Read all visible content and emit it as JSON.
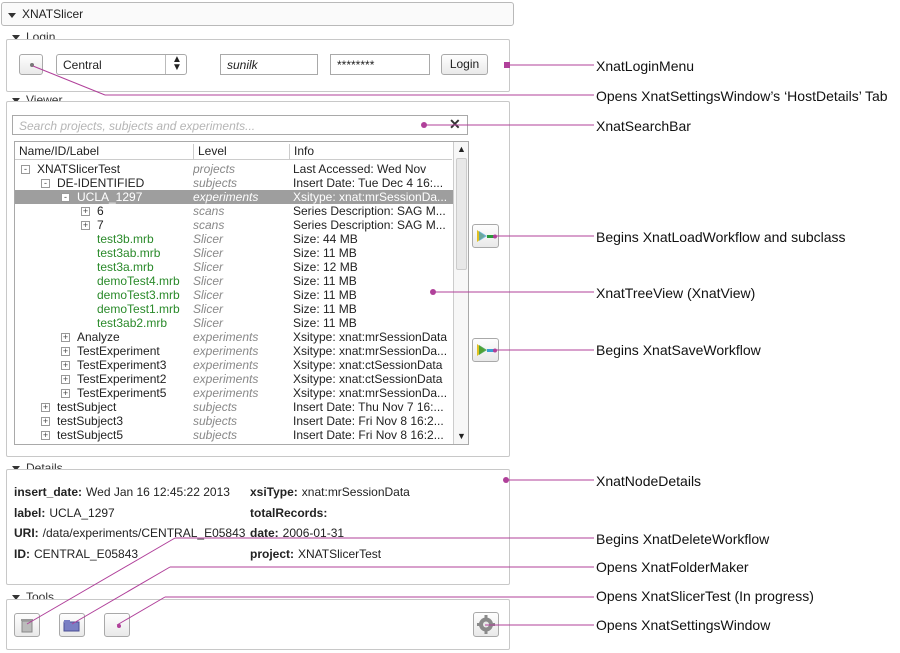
{
  "app": {
    "title": "XNATSlicer"
  },
  "login": {
    "section_label": "Login",
    "host": "Central",
    "username": "sunilk",
    "password": "********",
    "login_button": "Login"
  },
  "viewer": {
    "section_label": "Viewer",
    "search_placeholder": "Search projects, subjects and experiments...",
    "columns": [
      "Name/ID/Label",
      "Level",
      "Info"
    ],
    "rows": [
      {
        "name": "XNATSlicerTest",
        "level": "projects",
        "info": "Last Accessed: Wed Nov",
        "depth": 0,
        "exp": "-",
        "green": false,
        "sel": false
      },
      {
        "name": "DE-IDENTIFIED",
        "level": "subjects",
        "info": "Insert Date: Tue Dec  4 16:...",
        "depth": 1,
        "exp": "-",
        "green": false,
        "sel": false
      },
      {
        "name": "UCLA_1297",
        "level": "experiments",
        "info": "Xsitype: xnat:mrSessionDa...",
        "depth": 2,
        "exp": "-",
        "green": false,
        "sel": true
      },
      {
        "name": "6",
        "level": "scans",
        "info": "Series Description: SAG M...",
        "depth": 3,
        "exp": "+",
        "green": false,
        "sel": false
      },
      {
        "name": "7",
        "level": "scans",
        "info": "Series Description: SAG M...",
        "depth": 3,
        "exp": "+",
        "green": false,
        "sel": false
      },
      {
        "name": "test3b.mrb",
        "level": "Slicer",
        "info": "Size: 44 MB",
        "depth": 3,
        "exp": "",
        "green": true,
        "sel": false
      },
      {
        "name": "test3ab.mrb",
        "level": "Slicer",
        "info": "Size: 11 MB",
        "depth": 3,
        "exp": "",
        "green": true,
        "sel": false
      },
      {
        "name": "test3a.mrb",
        "level": "Slicer",
        "info": "Size: 12 MB",
        "depth": 3,
        "exp": "",
        "green": true,
        "sel": false
      },
      {
        "name": "demoTest4.mrb",
        "level": "Slicer",
        "info": "Size: 11 MB",
        "depth": 3,
        "exp": "",
        "green": true,
        "sel": false
      },
      {
        "name": "demoTest3.mrb",
        "level": "Slicer",
        "info": "Size: 11 MB",
        "depth": 3,
        "exp": "",
        "green": true,
        "sel": false
      },
      {
        "name": "demoTest1.mrb",
        "level": "Slicer",
        "info": "Size: 11 MB",
        "depth": 3,
        "exp": "",
        "green": true,
        "sel": false
      },
      {
        "name": "test3ab2.mrb",
        "level": "Slicer",
        "info": "Size: 11 MB",
        "depth": 3,
        "exp": "",
        "green": true,
        "sel": false
      },
      {
        "name": "Analyze",
        "level": "experiments",
        "info": "Xsitype: xnat:mrSessionData",
        "depth": 2,
        "exp": "+",
        "green": false,
        "sel": false
      },
      {
        "name": "TestExperiment",
        "level": "experiments",
        "info": "Xsitype: xnat:mrSessionDa...",
        "depth": 2,
        "exp": "+",
        "green": false,
        "sel": false
      },
      {
        "name": "TestExperiment3",
        "level": "experiments",
        "info": "Xsitype: xnat:ctSessionData",
        "depth": 2,
        "exp": "+",
        "green": false,
        "sel": false
      },
      {
        "name": "TestExperiment2",
        "level": "experiments",
        "info": "Xsitype: xnat:ctSessionData",
        "depth": 2,
        "exp": "+",
        "green": false,
        "sel": false
      },
      {
        "name": "TestExperiment5",
        "level": "experiments",
        "info": "Xsitype: xnat:mrSessionDa...",
        "depth": 2,
        "exp": "+",
        "green": false,
        "sel": false
      },
      {
        "name": "testSubject",
        "level": "subjects",
        "info": "Insert Date: Thu Nov  7 16:...",
        "depth": 1,
        "exp": "+",
        "green": false,
        "sel": false
      },
      {
        "name": "testSubject3",
        "level": "subjects",
        "info": "Insert Date: Fri Nov  8 16:2...",
        "depth": 1,
        "exp": "+",
        "green": false,
        "sel": false
      },
      {
        "name": "testSubject5",
        "level": "subjects",
        "info": "Insert Date: Fri Nov  8 16:2...",
        "depth": 1,
        "exp": "+",
        "green": false,
        "sel": false
      }
    ]
  },
  "details": {
    "section_label": "Details",
    "left": [
      {
        "k": "insert_date:",
        "v": "Wed Jan 16 12:45:22 2013"
      },
      {
        "k": "label:",
        "v": "UCLA_1297"
      },
      {
        "k": "URI:",
        "v": "/data/experiments/CENTRAL_E05843"
      },
      {
        "k": "ID:",
        "v": "CENTRAL_E05843"
      }
    ],
    "right": [
      {
        "k": "xsiType:",
        "v": "xnat:mrSessionData"
      },
      {
        "k": "totalRecords:",
        "v": ""
      },
      {
        "k": "date:",
        "v": "2006-01-31"
      },
      {
        "k": "project:",
        "v": "XNATSlicerTest"
      }
    ]
  },
  "tools": {
    "section_label": "Tools"
  },
  "annotations": {
    "login_menu": "XnatLoginMenu",
    "settings_tab": "Opens XnatSettingsWindow’s ‘HostDetails’ Tab",
    "search_bar": "XnatSearchBar",
    "load_workflow": "Begins XnatLoadWorkflow and subclass",
    "tree_view": "XnatTreeView (XnatView)",
    "save_workflow": "Begins XnatSaveWorkflow",
    "node_details": "XnatNodeDetails",
    "delete_workflow": "Begins XnatDeleteWorkflow",
    "folder_maker": "Opens XnatFolderMaker",
    "slicer_test": "Opens XnatSlicerTest (In progress)",
    "settings_window": "Opens XnatSettingsWindow"
  },
  "colors": {
    "annotation_line": "#b0409a",
    "selected_row": "#9e9e9e",
    "slicer_file": "#2a8a2a"
  }
}
